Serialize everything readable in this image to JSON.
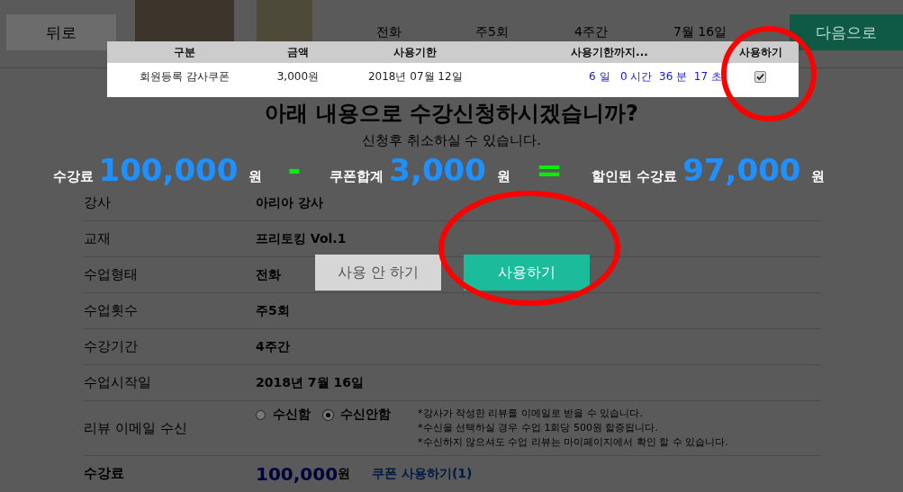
{
  "top_bar": {
    "back_button": "뒤로",
    "summary": [
      "전화",
      "주5회",
      "4주간",
      "7월 16일"
    ],
    "next_button": "다음으로"
  },
  "coupon_popup": {
    "columns": [
      "구분",
      "금액",
      "사용기한",
      "사용기한까지...",
      "사용하기"
    ],
    "rows": [
      {
        "name": "회원등록 감사쿠폰",
        "amount": "3,000원",
        "expiry": "2018년 07월 12일",
        "remaining": "6 일   0 시간  36 분  17 초",
        "checked": true
      }
    ]
  },
  "heading": "아래 내용으로 수강신청하시겠습니까?",
  "subheading": "신청후 취소하실 수 있습니다.",
  "price_summary": [
    {
      "kind": "term",
      "label": "수강료",
      "amount": "100,000",
      "unit": "원"
    },
    {
      "kind": "operator",
      "symbol": "-"
    },
    {
      "kind": "term",
      "label": "쿠폰합계",
      "amount": "3,000",
      "unit": "원"
    },
    {
      "kind": "operator",
      "symbol": "="
    },
    {
      "kind": "term",
      "label": "할인된 수강료",
      "amount": "97,000",
      "unit": "원"
    }
  ],
  "dialog_buttons": [
    {
      "label": "사용 안 하기",
      "kind": "secondary"
    },
    {
      "label": "사용하기",
      "kind": "primary"
    }
  ],
  "details": [
    {
      "kind": "text",
      "label": "강사",
      "value": "아리아 강사"
    },
    {
      "kind": "text",
      "label": "교재",
      "value": "프리토킹 Vol.1"
    },
    {
      "kind": "text",
      "label": "수업형태",
      "value": "전화"
    },
    {
      "kind": "text",
      "label": "수업횟수",
      "value": "주5회"
    },
    {
      "kind": "text",
      "label": "수강기간",
      "value": "4주간"
    },
    {
      "kind": "text",
      "label": "수업시작일",
      "value": "2018년 7월 16일"
    },
    {
      "kind": "radio",
      "label": "리뷰 이메일 수신",
      "options": [
        {
          "label": "수신함",
          "selected": false
        },
        {
          "label": "수신안함",
          "selected": true
        }
      ],
      "notes": [
        "*강사가 작성한 리뷰를 이메일로 받을 수 있습니다.",
        "*수신을 선택하실 경우 수업 1회당 500원 할증됩니다.",
        "*수신하지 않으셔도 수업 리뷰는 마이페이지에서 확인 할 수 있습니다."
      ]
    },
    {
      "kind": "price",
      "label": "수강료",
      "value": "100,000",
      "unit": "원",
      "link": "쿠폰 사용하기(1)"
    }
  ]
}
